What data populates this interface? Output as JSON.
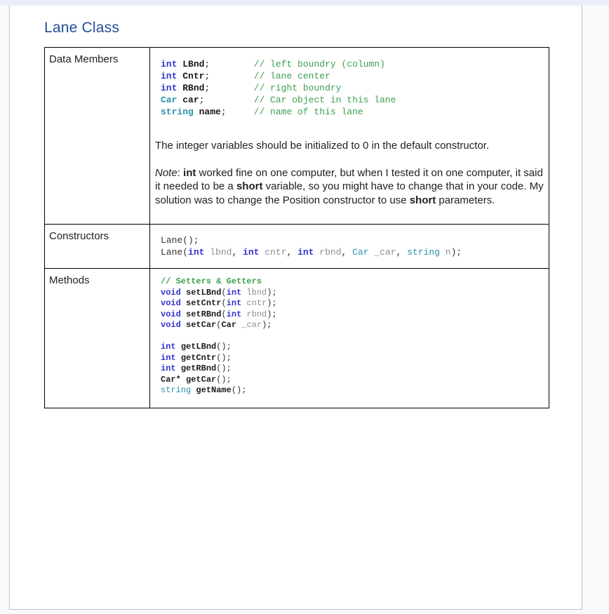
{
  "page": {
    "title": "Lane Class"
  },
  "colors": {
    "title_blue": "#234e99",
    "keyword_blue": "#3232cf",
    "type_teal": "#2b91af",
    "comment_green": "#3aa04f",
    "param_gray": "#8e8e8e",
    "top_strip": "#e9eef8",
    "page_background": "#f9fafc",
    "table_border": "#000000"
  },
  "table": {
    "rows": [
      {
        "label": "Data Members",
        "code": [
          [
            [
              "k",
              "int"
            ],
            [
              "p",
              " "
            ],
            [
              "n",
              "LBnd"
            ],
            [
              "p",
              ";        "
            ],
            [
              "c",
              "// left boundry (column)"
            ]
          ],
          [
            [
              "k",
              "int"
            ],
            [
              "p",
              " "
            ],
            [
              "n",
              "Cntr"
            ],
            [
              "p",
              ";        "
            ],
            [
              "c",
              "// lane center"
            ]
          ],
          [
            [
              "k",
              "int"
            ],
            [
              "p",
              " "
            ],
            [
              "n",
              "RBnd"
            ],
            [
              "p",
              ";        "
            ],
            [
              "c",
              "// right boundry"
            ]
          ],
          [
            [
              "tb",
              "Car"
            ],
            [
              "p",
              " "
            ],
            [
              "n",
              "car"
            ],
            [
              "p",
              ";         "
            ],
            [
              "c",
              "// Car object in this lane"
            ]
          ],
          [
            [
              "tb",
              "string"
            ],
            [
              "p",
              " "
            ],
            [
              "n",
              "name"
            ],
            [
              "p",
              ";     "
            ],
            [
              "c",
              "// name of this lane"
            ]
          ]
        ],
        "paragraphs": [
          [
            [
              "r",
              "The integer variables should be initialized to 0 in the default constructor."
            ]
          ],
          [
            [
              "i",
              "Note"
            ],
            [
              "r",
              ": "
            ],
            [
              "b",
              "int"
            ],
            [
              "r",
              " worked fine on one computer, but when I tested it on one computer, it said it needed to be a "
            ],
            [
              "b",
              "short"
            ],
            [
              "r",
              " variable, so you might have to change that in your code. My solution was to change the Position constructor to use "
            ],
            [
              "b",
              "short"
            ],
            [
              "r",
              " parameters."
            ]
          ]
        ]
      },
      {
        "label": "Constructors",
        "code": [
          [
            [
              "p",
              "Lane();"
            ]
          ],
          [
            [
              "p",
              "Lane("
            ],
            [
              "k",
              "int"
            ],
            [
              "g",
              " lbnd"
            ],
            [
              "p",
              ", "
            ],
            [
              "k",
              "int"
            ],
            [
              "g",
              " cntr"
            ],
            [
              "p",
              ", "
            ],
            [
              "k",
              "int"
            ],
            [
              "g",
              " rbnd"
            ],
            [
              "p",
              ", "
            ],
            [
              "t",
              "Car"
            ],
            [
              "g",
              " _car"
            ],
            [
              "p",
              ", "
            ],
            [
              "t",
              "string"
            ],
            [
              "g",
              " n"
            ],
            [
              "p",
              ");"
            ]
          ]
        ]
      },
      {
        "label": "Methods",
        "code": [
          [
            [
              "cb",
              "// Setters & Getters"
            ]
          ],
          [
            [
              "k",
              "void"
            ],
            [
              "p",
              " "
            ],
            [
              "n",
              "setLBnd"
            ],
            [
              "p",
              "("
            ],
            [
              "k",
              "int"
            ],
            [
              "g",
              " lbnd"
            ],
            [
              "p",
              ");"
            ]
          ],
          [
            [
              "k",
              "void"
            ],
            [
              "p",
              " "
            ],
            [
              "n",
              "setCntr"
            ],
            [
              "p",
              "("
            ],
            [
              "k",
              "int"
            ],
            [
              "g",
              " cntr"
            ],
            [
              "p",
              ");"
            ]
          ],
          [
            [
              "k",
              "void"
            ],
            [
              "p",
              " "
            ],
            [
              "n",
              "setRBnd"
            ],
            [
              "p",
              "("
            ],
            [
              "k",
              "int"
            ],
            [
              "g",
              " rbnd"
            ],
            [
              "p",
              ");"
            ]
          ],
          [
            [
              "k",
              "void"
            ],
            [
              "p",
              " "
            ],
            [
              "n",
              "setCar"
            ],
            [
              "p",
              "("
            ],
            [
              "n",
              "Car"
            ],
            [
              "g",
              " _car"
            ],
            [
              "p",
              ");"
            ]
          ],
          [],
          [
            [
              "k",
              "int"
            ],
            [
              "p",
              " "
            ],
            [
              "n",
              "getLBnd"
            ],
            [
              "p",
              "();"
            ]
          ],
          [
            [
              "k",
              "int"
            ],
            [
              "p",
              " "
            ],
            [
              "n",
              "getCntr"
            ],
            [
              "p",
              "();"
            ]
          ],
          [
            [
              "k",
              "int"
            ],
            [
              "p",
              " "
            ],
            [
              "n",
              "getRBnd"
            ],
            [
              "p",
              "();"
            ]
          ],
          [
            [
              "n",
              "Car*"
            ],
            [
              "p",
              " "
            ],
            [
              "n",
              "getCar"
            ],
            [
              "p",
              "();"
            ]
          ],
          [
            [
              "t",
              "string"
            ],
            [
              "p",
              " "
            ],
            [
              "n",
              "getName"
            ],
            [
              "p",
              "();"
            ]
          ]
        ]
      }
    ]
  }
}
